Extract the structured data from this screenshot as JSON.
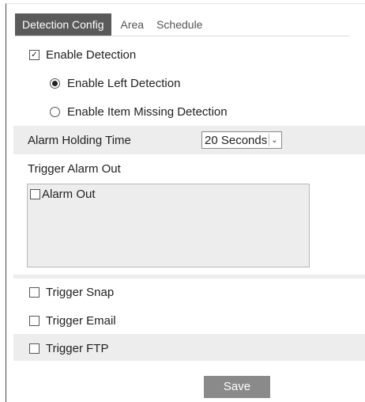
{
  "tabs": [
    {
      "label": "Detection Config",
      "active": true
    },
    {
      "label": "Area",
      "active": false
    },
    {
      "label": "Schedule",
      "active": false
    }
  ],
  "enable_detection": {
    "label": "Enable Detection",
    "checked": true
  },
  "detection_mode": {
    "options": [
      {
        "label": "Enable Left Detection",
        "selected": true
      },
      {
        "label": "Enable Item Missing Detection",
        "selected": false
      }
    ]
  },
  "alarm_holding_time": {
    "label": "Alarm Holding Time",
    "value": "20 Seconds"
  },
  "trigger_alarm_out": {
    "label": "Trigger Alarm Out",
    "items": [
      {
        "label": "Alarm Out",
        "checked": false
      }
    ]
  },
  "triggers": {
    "snap": {
      "label": "Trigger Snap",
      "checked": false
    },
    "email": {
      "label": "Trigger Email",
      "checked": false
    },
    "ftp": {
      "label": "Trigger FTP",
      "checked": false
    }
  },
  "save_label": "Save",
  "colors": {
    "tab_active_bg": "#5a5a5a",
    "row_shade": "#ededed",
    "button_bg": "#8a8a8a"
  }
}
